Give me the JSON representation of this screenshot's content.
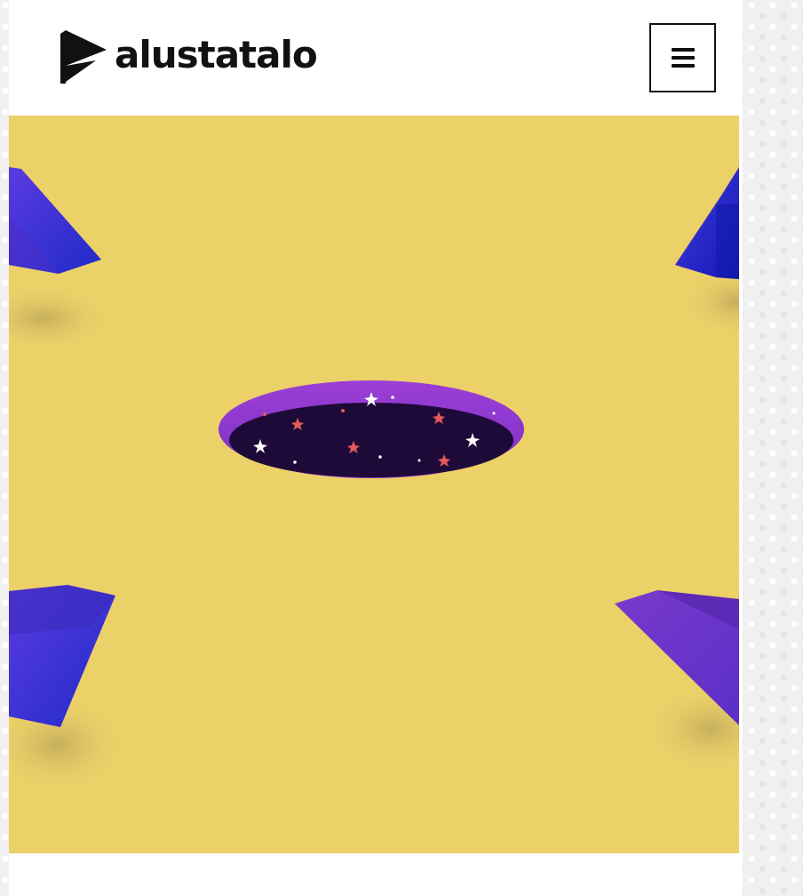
{
  "header": {
    "logo": {
      "icon": "alustatalo-flag-logo-icon",
      "text": "alustatalo"
    },
    "menu_button": {
      "icon": "hamburger-menu-icon"
    }
  },
  "hero": {
    "illustration": "portal-hole-with-stars-illustration",
    "colors": {
      "background": "#ecd068",
      "portal_rim": "#8c35d0",
      "portal_inner": "#1e0a38",
      "crystal_blue": "#2a2fd0",
      "crystal_violet": "#6d35c8",
      "star_white": "#ffffff",
      "star_red": "#e05a5a"
    }
  }
}
